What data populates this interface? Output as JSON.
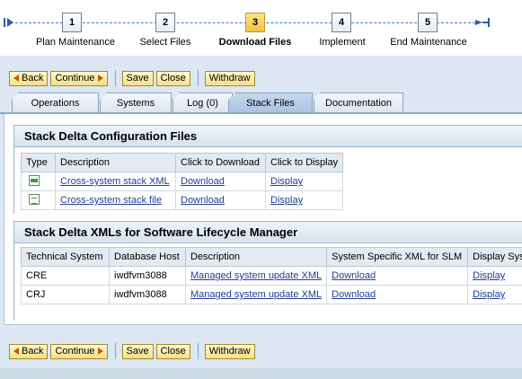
{
  "roadmap": {
    "steps": [
      {
        "number": "1",
        "label": "Plan Maintenance"
      },
      {
        "number": "2",
        "label": "Select Files"
      },
      {
        "number": "3",
        "label": "Download Files"
      },
      {
        "number": "4",
        "label": "Implement"
      },
      {
        "number": "5",
        "label": "End Maintenance"
      }
    ],
    "active_step": "3"
  },
  "toolbar": {
    "back": "Back",
    "continue": "Continue",
    "save": "Save",
    "close": "Close",
    "withdraw": "Withdraw"
  },
  "tabs": [
    {
      "label": "Operations"
    },
    {
      "label": "Systems"
    },
    {
      "label": "Log (0)"
    },
    {
      "label": "Stack Files",
      "active": true
    },
    {
      "label": "Documentation"
    }
  ],
  "stack_delta_config": {
    "title": "Stack Delta Configuration Files",
    "columns": [
      "Type",
      "Description",
      "Click to Download",
      "Click to Display"
    ],
    "rows": [
      {
        "type_icon": "xml-file-icon",
        "description": "Cross-system stack XML",
        "download": "Download",
        "display": "Display"
      },
      {
        "type_icon": "text-file-icon",
        "description": "Cross-system stack file",
        "download": "Download",
        "display": "Display"
      }
    ]
  },
  "stack_delta_xmls": {
    "title": "Stack Delta XMLs for Software Lifecycle Manager",
    "columns": [
      "Technical System",
      "Database Host",
      "Description",
      "System Specific XML  for SLM",
      "Display Syst"
    ],
    "rows": [
      {
        "system": "CRE",
        "host": "iwdfvm3088",
        "description": "Managed system update XML",
        "download": "Download",
        "display": "Display"
      },
      {
        "system": "CRJ",
        "host": "iwdfvm3088",
        "description": "Managed system update XML",
        "download": "Download",
        "display": "Display"
      }
    ]
  },
  "colors": {
    "accent_blue": "#4a7ab8",
    "active_step": "#f5c242",
    "button_fill": "#f6df88",
    "link": "#1f3f94"
  }
}
